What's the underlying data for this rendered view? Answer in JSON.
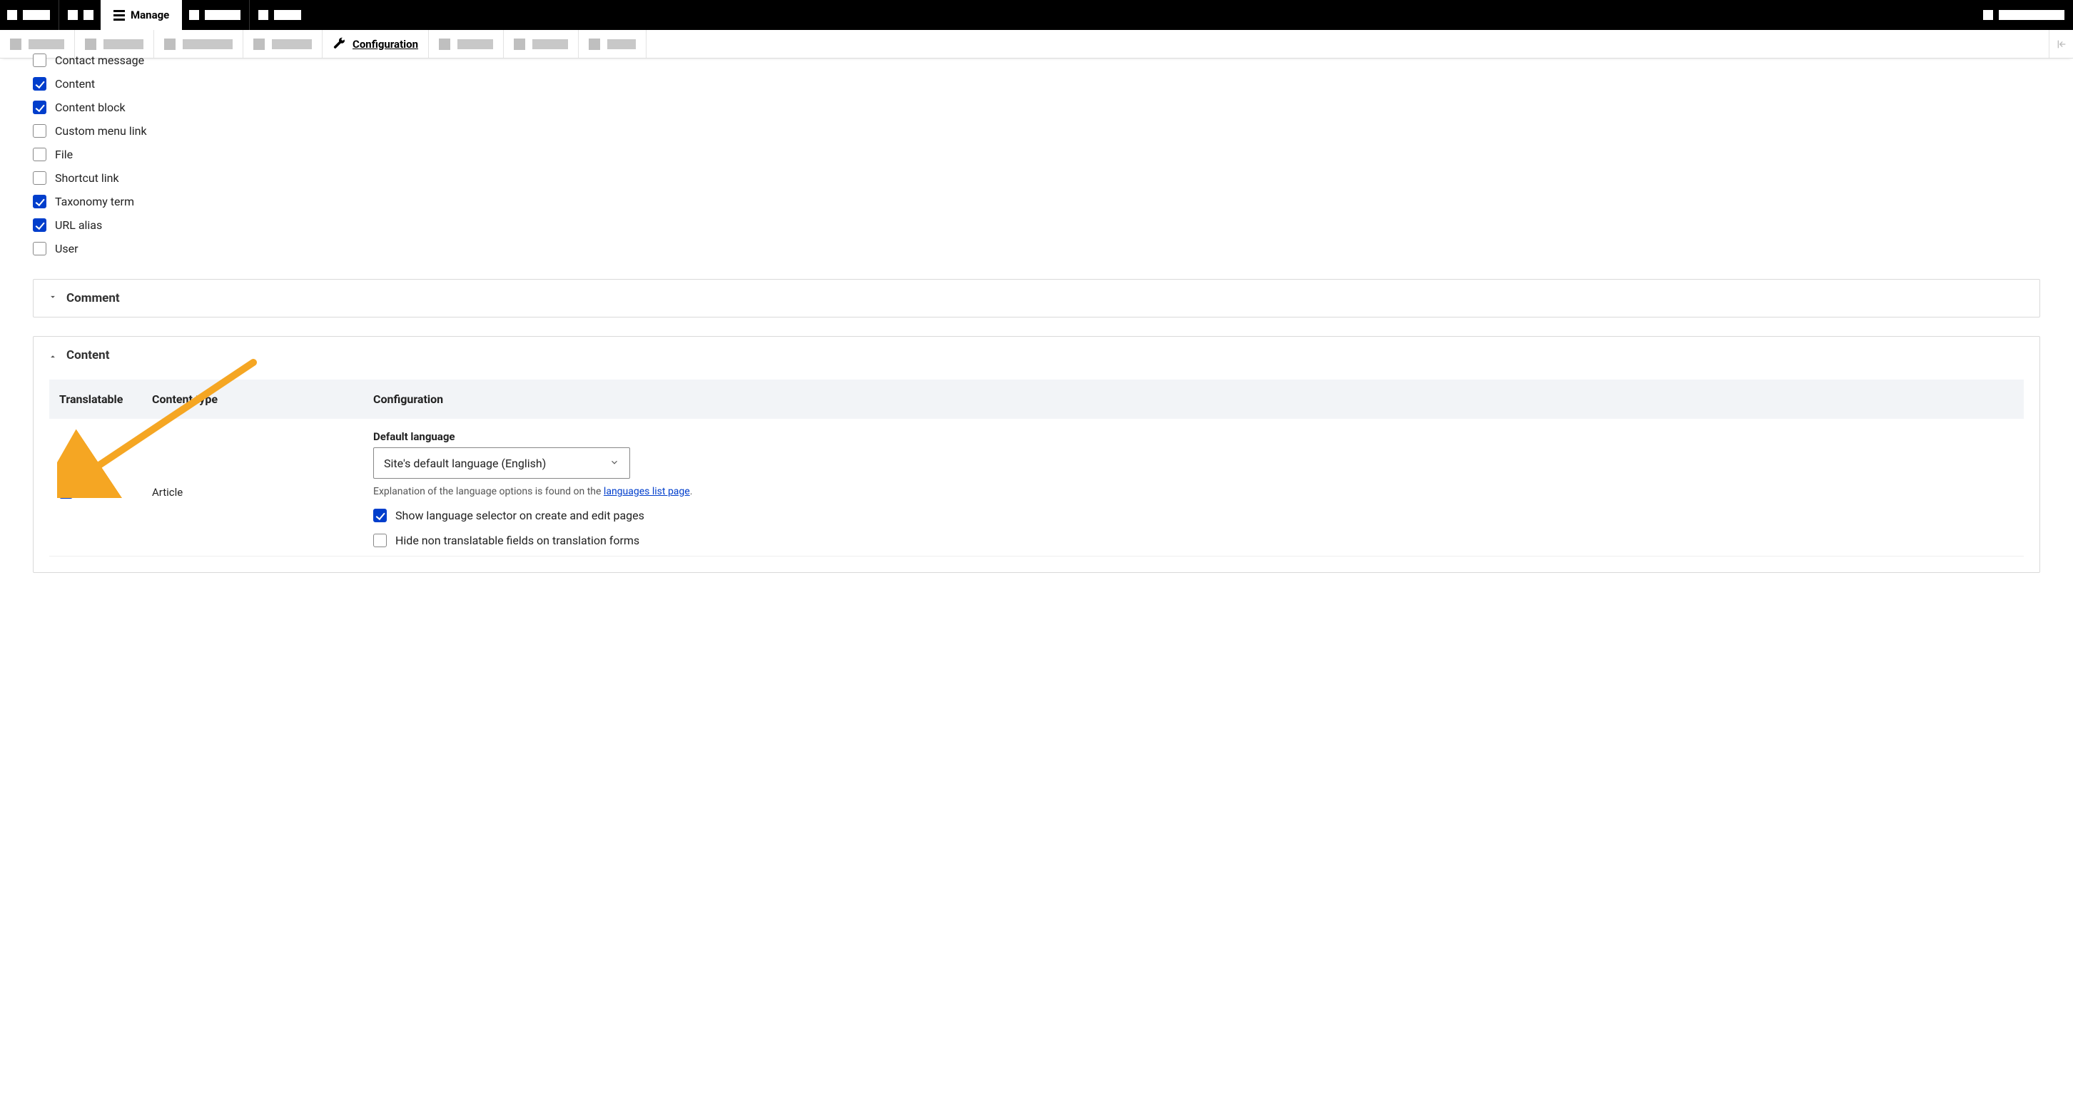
{
  "topbar": {
    "active_tab": "Manage"
  },
  "subbar": {
    "active_label": "Configuration"
  },
  "entity_types": [
    {
      "label": "Contact message",
      "checked": false
    },
    {
      "label": "Content",
      "checked": true
    },
    {
      "label": "Content block",
      "checked": true
    },
    {
      "label": "Custom menu link",
      "checked": false
    },
    {
      "label": "File",
      "checked": false
    },
    {
      "label": "Shortcut link",
      "checked": false
    },
    {
      "label": "Taxonomy term",
      "checked": true
    },
    {
      "label": "URL alias",
      "checked": true
    },
    {
      "label": "User",
      "checked": false
    }
  ],
  "sections": {
    "comment": {
      "title": "Comment",
      "open": false
    },
    "content": {
      "title": "Content",
      "open": true,
      "columns": {
        "translatable": "Translatable",
        "type": "Content type",
        "config": "Configuration"
      },
      "row": {
        "translatable_checked": true,
        "type_label": "Article",
        "default_lang_label": "Default language",
        "default_lang_value": "Site's default language (English)",
        "help_prefix": "Explanation of the language options is found on the ",
        "help_link": "languages list page",
        "help_suffix": ".",
        "show_selector": {
          "checked": true,
          "label": "Show language selector on create and edit pages"
        },
        "hide_fields": {
          "checked": false,
          "label": "Hide non translatable fields on translation forms"
        }
      }
    }
  }
}
